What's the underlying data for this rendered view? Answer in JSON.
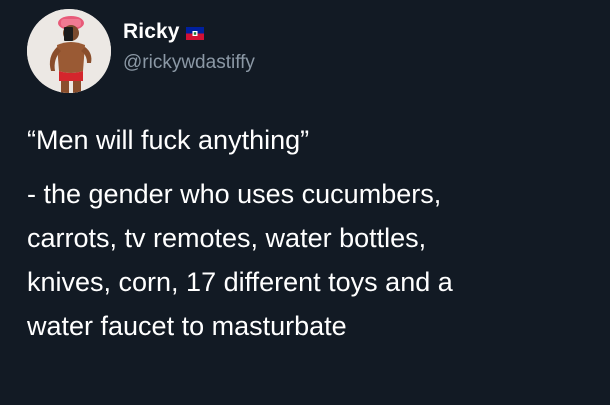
{
  "author": {
    "display_name": "Ricky",
    "handle": "@rickywdastiffy",
    "flag_icon": "haiti-flag-icon",
    "avatar_icon": "profile-photo-icon"
  },
  "tweet": {
    "quote": "“Men will fuck anything”",
    "lines": [
      "- the gender who uses cucumbers,",
      "carrots, tv remotes, water bottles,",
      "knives, corn, 17 different toys and a",
      "water faucet to masturbate"
    ]
  },
  "colors": {
    "background": "#121a24",
    "text": "#ffffff",
    "handle": "#8b98a5",
    "flag_blue": "#00209f",
    "flag_red": "#d21034"
  }
}
